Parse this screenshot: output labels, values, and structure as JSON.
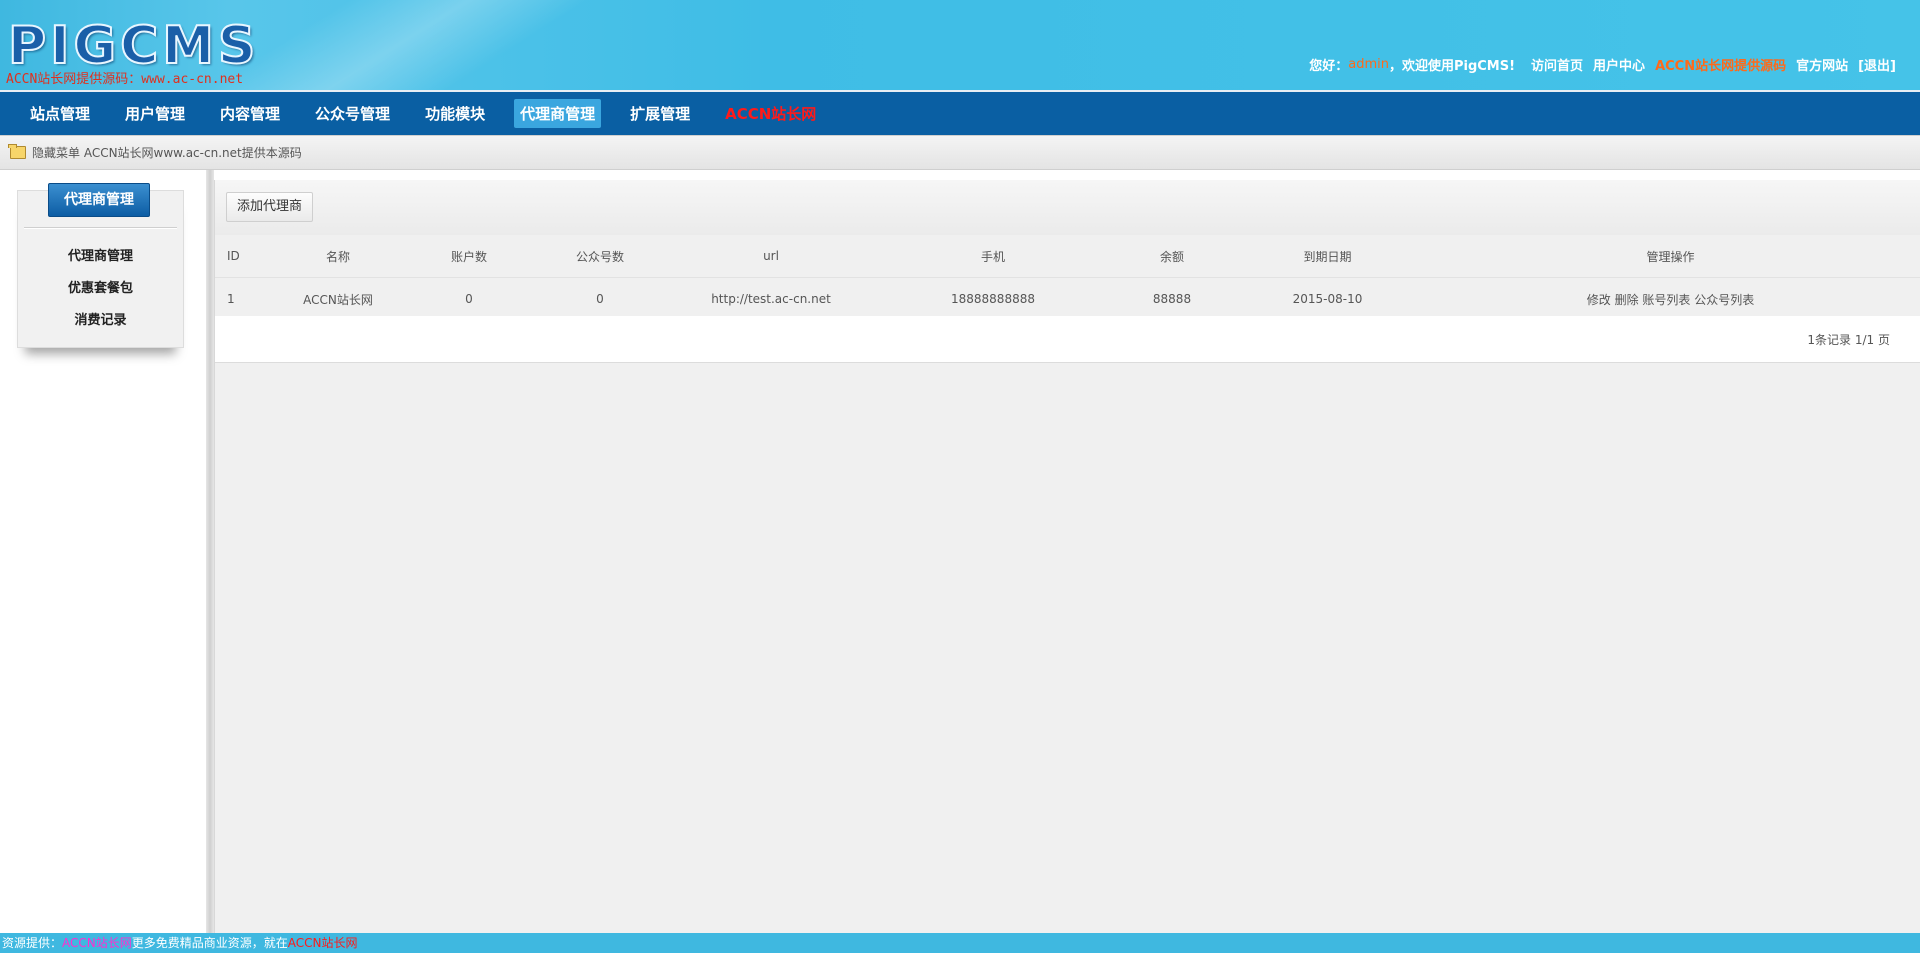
{
  "header": {
    "logo": "PIGCMS",
    "logo_sub": "ACCN站长网提供源码：www.ac-cn.net",
    "greeting": "您好：",
    "username": "admin",
    "welcome": "，欢迎使用PigCMS!",
    "links": [
      {
        "label": "访问首页",
        "color": "#ffffff"
      },
      {
        "label": "用户中心",
        "color": "#ffffff"
      },
      {
        "label": "ACCN站长网提供源码",
        "color": "#ff6a1a"
      },
      {
        "label": "官方网站",
        "color": "#ffffff"
      },
      {
        "label": "[退出]",
        "color": "#ffffff"
      }
    ]
  },
  "nav": {
    "items": [
      {
        "label": "站点管理"
      },
      {
        "label": "用户管理"
      },
      {
        "label": "内容管理"
      },
      {
        "label": "公众号管理"
      },
      {
        "label": "功能模块"
      },
      {
        "label": "代理商管理",
        "active": true
      },
      {
        "label": "扩展管理"
      },
      {
        "label": "ACCN站长网",
        "color": "#ff1a1a"
      }
    ]
  },
  "breadcrumb": {
    "text": "隐藏菜单 ACCN站长网www.ac-cn.net提供本源码"
  },
  "sidebar": {
    "title": "代理商管理",
    "items": [
      {
        "label": "代理商管理"
      },
      {
        "label": "优惠套餐包"
      },
      {
        "label": "消费记录"
      }
    ]
  },
  "toolbar": {
    "add_label": "添加代理商"
  },
  "table": {
    "columns": [
      "ID",
      "名称",
      "账户数",
      "公众号数",
      "url",
      "手机",
      "余额",
      "到期日期",
      "管理操作"
    ],
    "rows": [
      {
        "id": "1",
        "name": "ACCN站长网",
        "accounts": "0",
        "mp_count": "0",
        "url": "http://test.ac-cn.net",
        "phone": "18888888888",
        "balance": "88888",
        "expire": "2015-08-10",
        "actions": [
          "修改",
          "删除",
          "账号列表",
          "公众号列表"
        ]
      }
    ]
  },
  "pager": {
    "text": "1条记录 1/1 页"
  },
  "footer": {
    "prefix": "资源提供：",
    "site1": "ACCN站长网",
    "middle": "更多免费精品商业资源，就在",
    "site2": "ACCN站长网"
  }
}
